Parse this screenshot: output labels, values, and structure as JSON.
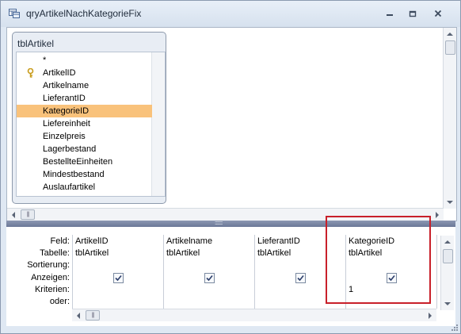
{
  "window": {
    "title": "qryArtikelNachKategorieFix"
  },
  "table": {
    "name": "tblArtikel",
    "fields": [
      {
        "label": "*",
        "key": false,
        "selected": false
      },
      {
        "label": "ArtikelID",
        "key": true,
        "selected": false
      },
      {
        "label": "Artikelname",
        "key": false,
        "selected": false
      },
      {
        "label": "LieferantID",
        "key": false,
        "selected": false
      },
      {
        "label": "KategorieID",
        "key": false,
        "selected": true
      },
      {
        "label": "Liefereinheit",
        "key": false,
        "selected": false
      },
      {
        "label": "Einzelpreis",
        "key": false,
        "selected": false
      },
      {
        "label": "Lagerbestand",
        "key": false,
        "selected": false
      },
      {
        "label": "BestellteEinheiten",
        "key": false,
        "selected": false
      },
      {
        "label": "Mindestbestand",
        "key": false,
        "selected": false
      },
      {
        "label": "Auslaufartikel",
        "key": false,
        "selected": false
      }
    ]
  },
  "grid": {
    "row_labels": {
      "feld": "Feld:",
      "tabelle": "Tabelle:",
      "sortierung": "Sortierung:",
      "anzeigen": "Anzeigen:",
      "kriterien": "Kriterien:",
      "oder": "oder:"
    },
    "columns": [
      {
        "feld": "ArtikelID",
        "tabelle": "tblArtikel",
        "sortierung": "",
        "anzeigen": true,
        "kriterien": "",
        "oder": ""
      },
      {
        "feld": "Artikelname",
        "tabelle": "tblArtikel",
        "sortierung": "",
        "anzeigen": true,
        "kriterien": "",
        "oder": ""
      },
      {
        "feld": "LieferantID",
        "tabelle": "tblArtikel",
        "sortierung": "",
        "anzeigen": true,
        "kriterien": "",
        "oder": ""
      },
      {
        "feld": "KategorieID",
        "tabelle": "tblArtikel",
        "sortierung": "",
        "anzeigen": true,
        "kriterien": "1",
        "oder": ""
      }
    ]
  },
  "colors": {
    "selection": "#f9c27b",
    "highlight_border": "#c8202a"
  }
}
